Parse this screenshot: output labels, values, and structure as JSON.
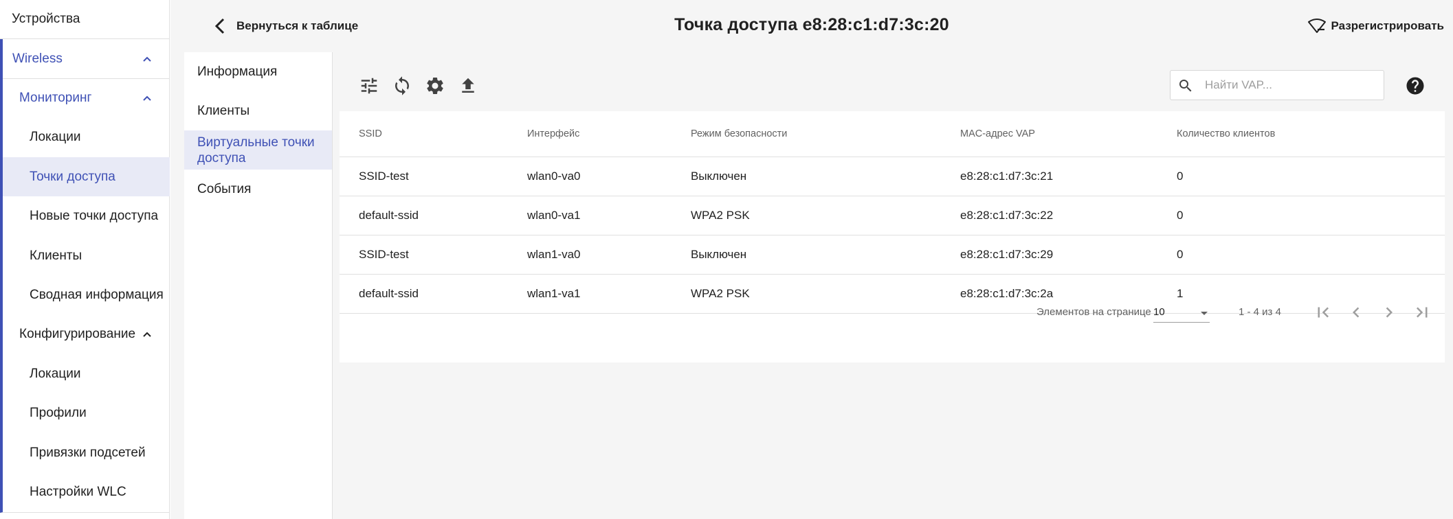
{
  "sidebar": {
    "top_item": "Устройства",
    "wireless": "Wireless",
    "monitoring": "Мониторинг",
    "monitoring_items": [
      "Локации",
      "Точки доступа",
      "Новые точки доступа",
      "Клиенты",
      "Сводная информация"
    ],
    "configuration": "Конфигурирование",
    "configuration_items": [
      "Локации",
      "Профили",
      "Привязки подсетей",
      "Настройки WLC"
    ],
    "active_item": "Точки доступа"
  },
  "header": {
    "back_label": "Вернуться к таблице",
    "title": "Точка доступа e8:28:c1:d7:3c:20",
    "unregister_label": "Разрегистрировать"
  },
  "subnav": {
    "items": [
      "Информация",
      "Клиенты",
      "Виртуальные точки доступа",
      "События"
    ],
    "active_index": 2
  },
  "toolbar": {
    "icons": [
      "tune-icon",
      "sync-icon",
      "settings-icon",
      "upload-icon"
    ],
    "search_placeholder": "Найти VAP...",
    "help_icon": "help-icon"
  },
  "table": {
    "columns": [
      "SSID",
      "Интерфейс",
      "Режим безопасности",
      "MAC-адрес VAP",
      "Количество клиентов"
    ],
    "rows": [
      [
        "SSID-test",
        "wlan0-va0",
        "Выключен",
        "e8:28:c1:d7:3c:21",
        "0"
      ],
      [
        "default-ssid",
        "wlan0-va1",
        "WPA2 PSK",
        "e8:28:c1:d7:3c:22",
        "0"
      ],
      [
        "SSID-test",
        "wlan1-va0",
        "Выключен",
        "e8:28:c1:d7:3c:29",
        "0"
      ],
      [
        "default-ssid",
        "wlan1-va1",
        "WPA2 PSK",
        "e8:28:c1:d7:3c:2a",
        "1"
      ]
    ]
  },
  "paginator": {
    "items_per_page_label": "Элементов на странице",
    "page_size": "10",
    "range_label": "1 - 4 из 4"
  },
  "colors": {
    "accent": "#3f51b5",
    "active_bg": "#e8eaf6",
    "panel_bg": "#f5f5f5",
    "divider": "#e0e0e0"
  }
}
